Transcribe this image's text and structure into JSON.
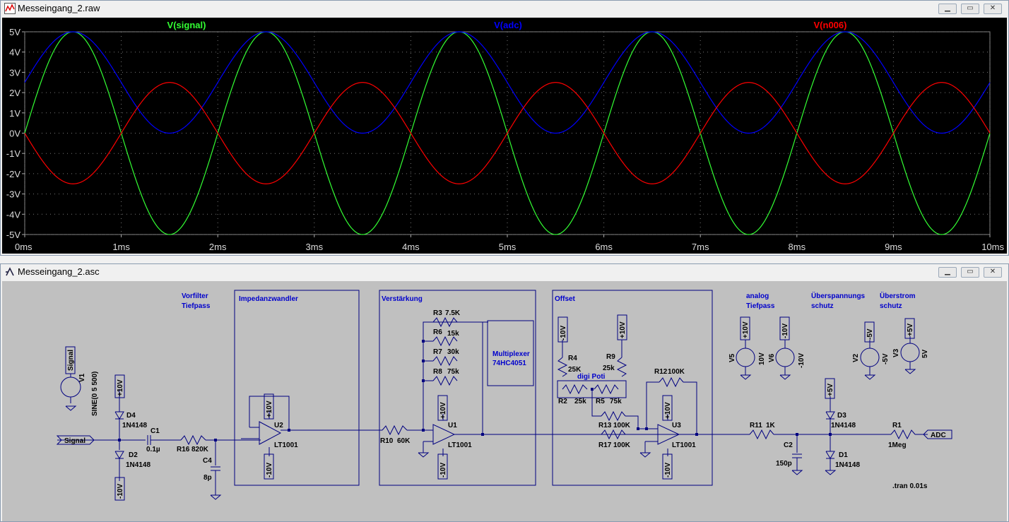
{
  "waveform_window": {
    "title": "Messeingang_2.raw",
    "traces": [
      {
        "name": "V(signal)",
        "color": "#33ff33",
        "amplitude": 5,
        "offset": 0,
        "phase_deg": 0
      },
      {
        "name": "V(adc)",
        "color": "#0000ff",
        "amplitude": 2.5,
        "offset": 2.5,
        "phase_deg": 0
      },
      {
        "name": "V(n006)",
        "color": "#ff0000",
        "amplitude": -2.5,
        "offset": 0,
        "phase_deg": 0
      }
    ],
    "y_ticks": [
      "5V",
      "4V",
      "3V",
      "2V",
      "1V",
      "0V",
      "-1V",
      "-2V",
      "-3V",
      "-4V",
      "-5V"
    ],
    "x_ticks": [
      "0ms",
      "1ms",
      "2ms",
      "3ms",
      "4ms",
      "5ms",
      "6ms",
      "7ms",
      "8ms",
      "9ms",
      "10ms"
    ]
  },
  "chart_data": {
    "type": "line",
    "xlabel": "",
    "ylabel": "",
    "xlim": [
      0,
      10
    ],
    "ylim": [
      -5,
      5
    ],
    "x_unit": "ms",
    "frequency_hz": 500,
    "series": [
      {
        "name": "V(signal)",
        "formula": "5*sin(2*pi*500*t)",
        "y_max": 5,
        "y_min": -5
      },
      {
        "name": "V(adc)",
        "formula": "2.5+2.5*sin(2*pi*500*t)",
        "y_max": 5,
        "y_min": 0
      },
      {
        "name": "V(n006)",
        "formula": "-2.5*sin(2*pi*500*t)",
        "y_max": 2.5,
        "y_min": -2.5
      }
    ],
    "grid": true
  },
  "schematic_window": {
    "title": "Messeingang_2.asc",
    "blocks": [
      {
        "name": "Impedanzwandler"
      },
      {
        "name": "Verstärkung"
      },
      {
        "name": "Offset"
      }
    ],
    "notes": {
      "vorfilter1": "Vorfilter",
      "vorfilter2": "Tiefpass",
      "analog1": "analog",
      "analog2": "Tiefpass",
      "ueberspannung1": "Überspannungs",
      "ueberspannung2": "schutz",
      "ueberstrom1": "Überstrom",
      "ueberstrom2": "schutz",
      "multiplexer1": "Multiplexer",
      "multiplexer2": "74HC4051",
      "digipoti": "digi Poti",
      "tran": ".tran 0.01s"
    },
    "labels": {
      "signal_in": "Signal",
      "adc_out": "ADC",
      "signal_src": "Signal",
      "v1": "V1",
      "v1_value": "SINE(0 5 500)",
      "d4": "D4",
      "d4v": "1N4148",
      "d2": "D2",
      "d2v": "1N4148",
      "c1": "C1",
      "c1v": "0.1µ",
      "r16": "R16",
      "r16v": "820K",
      "c4": "C4",
      "c4v": "8p",
      "u2": "U2",
      "u2v": "LT1001",
      "r10": "R10",
      "r10v": "60K",
      "r3": "R3",
      "r3v": "7.5K",
      "r6": "R6",
      "r6v": "15k",
      "r7": "R7",
      "r7v": "30k",
      "r8": "R8",
      "r8v": "75k",
      "u1": "U1",
      "u1v": "LT1001",
      "r4": "R4",
      "r4v": "25K",
      "r9": "R9",
      "r9v": "25k",
      "r2": "R2",
      "r2v": "25k",
      "r5": "R5",
      "r5v": "75k",
      "r13": "R13",
      "r13v": "100K",
      "r17": "R17",
      "r17v": "100K",
      "r12": "R12",
      "r12v": "100K",
      "u3": "U3",
      "u3v": "LT1001",
      "r11": "R11",
      "r11v": "1K",
      "c2": "C2",
      "c2v": "150p",
      "d3": "D3",
      "d3v": "1N4148",
      "d1": "D1",
      "d1v": "1N4148",
      "r1": "R1",
      "r1v": "1Meg",
      "v5": "V5",
      "v5v": "10V",
      "v6": "V6",
      "v6v": "-10V",
      "v2": "V2",
      "v2v": "-5V",
      "v3": "V3",
      "v3v": "5V",
      "p10": "+10V",
      "m10": "-10V",
      "p5": "+5V",
      "m5": "-5V"
    }
  }
}
